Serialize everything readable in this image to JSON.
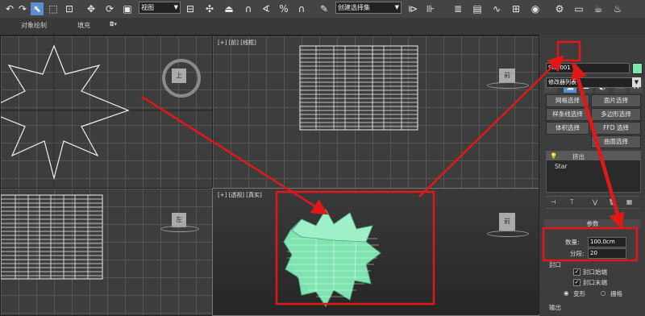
{
  "toolbar": {
    "view_dropdown": "视图",
    "selection_set_dropdown": "创建选择集",
    "icons": [
      "undo-icon",
      "select-icon",
      "region-select-icon",
      "window-crossing-icon",
      "move-icon",
      "rotate-icon",
      "scale-icon",
      "reference-coord-dropdown",
      "pivot-icon",
      "select-manipulate-icon",
      "snaps-toggle-icon",
      "angle-snap-icon",
      "percent-snap-icon",
      "spinner-snap-icon",
      "edit-named-selection-icon",
      "mirror-icon",
      "align-icon",
      "layer-manager-icon",
      "graphite-ribbon-icon",
      "curve-editor-icon",
      "schematic-view-icon",
      "material-editor-icon",
      "render-setup-icon",
      "rendered-frame-icon",
      "render-icon"
    ]
  },
  "ribbon": {
    "item1": "对象绘制",
    "item2": "填充"
  },
  "viewports": {
    "top_left_label": "",
    "top_right_label": "[+] [前] [线框]",
    "bottom_left_label": "",
    "bottom_right_label": "[+] [透视] [真实]",
    "viewcube_labels": [
      "上",
      "前",
      "左",
      "前"
    ]
  },
  "command_panel": {
    "tabs": [
      "create-tab",
      "modify-tab",
      "hierarchy-tab",
      "motion-tab",
      "display-tab",
      "utilities-tab"
    ],
    "active_tab": "modify-tab",
    "object_name": "Star001",
    "object_color": "#7fe3b0",
    "modifier_list": "修改器列表",
    "selection_buttons": [
      [
        "网格选择",
        "面片选择"
      ],
      [
        "样条线选择",
        "多边形选择"
      ],
      [
        "体积选择",
        "FFD 选择"
      ],
      [
        "",
        "曲面选择"
      ]
    ],
    "stack": {
      "modifier": "挤出",
      "base": "Star"
    },
    "params": {
      "header": "参数",
      "amount_label": "数量:",
      "amount_value": "100.0cm",
      "segments_label": "分段:",
      "segments_value": "20"
    },
    "cap": {
      "header": "封口",
      "cap_start": "封口始端",
      "cap_end": "封口末端",
      "morph": "变形",
      "grid": "栅格"
    },
    "output_header": "输出"
  },
  "colors": {
    "highlight_red": "#e01818",
    "mesh_green": "#7fe3b0",
    "accent_blue": "#5a8ed0"
  }
}
